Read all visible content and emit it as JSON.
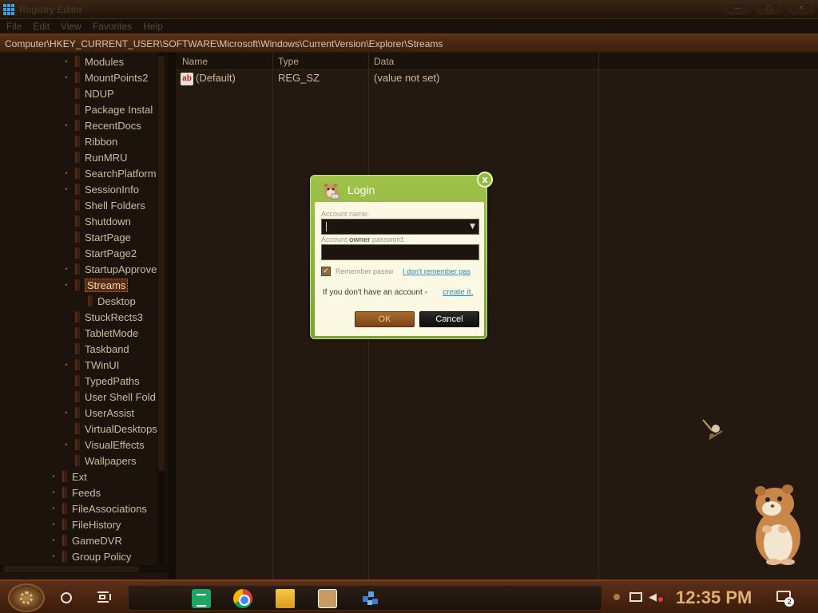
{
  "window": {
    "title": "Registry Editor",
    "buttons": [
      "—",
      "□",
      "✕"
    ]
  },
  "menu": [
    "File",
    "Edit",
    "View",
    "Favorites",
    "Help"
  ],
  "address": "Computer\\HKEY_CURRENT_USER\\SOFTWARE\\Microsoft\\Windows\\CurrentVersion\\Explorer\\Streams",
  "tree": [
    {
      "label": "Modules",
      "expander": true
    },
    {
      "label": "MountPoints2",
      "expander": true
    },
    {
      "label": "NDUP",
      "expander": false
    },
    {
      "label": "Package Instal",
      "expander": false
    },
    {
      "label": "RecentDocs",
      "expander": true
    },
    {
      "label": "Ribbon",
      "expander": false
    },
    {
      "label": "RunMRU",
      "expander": false
    },
    {
      "label": "SearchPlatform",
      "expander": true
    },
    {
      "label": "SessionInfo",
      "expander": true
    },
    {
      "label": "Shell Folders",
      "expander": false
    },
    {
      "label": "Shutdown",
      "expander": false
    },
    {
      "label": "StartPage",
      "expander": false
    },
    {
      "label": "StartPage2",
      "expander": false
    },
    {
      "label": "StartupApprove",
      "expander": true
    },
    {
      "label": "Streams",
      "expander": true,
      "selected": true
    },
    {
      "label": "Desktop",
      "expander": false
    },
    {
      "label": "StuckRects3",
      "expander": false
    },
    {
      "label": "TabletMode",
      "expander": false
    },
    {
      "label": "Taskband",
      "expander": false
    },
    {
      "label": "TWinUI",
      "expander": true
    },
    {
      "label": "TypedPaths",
      "expander": false
    },
    {
      "label": "User Shell Fold",
      "expander": false
    },
    {
      "label": "UserAssist",
      "expander": true
    },
    {
      "label": "VirtualDesktops",
      "expander": false
    },
    {
      "label": "VisualEffects",
      "expander": true
    },
    {
      "label": "Wallpapers",
      "expander": false
    },
    {
      "label": "Ext",
      "expander": true
    },
    {
      "label": "Feeds",
      "expander": true
    },
    {
      "label": "FileAssociations",
      "expander": true
    },
    {
      "label": "FileHistory",
      "expander": true
    },
    {
      "label": "GameDVR",
      "expander": true
    },
    {
      "label": "Group Policy",
      "expander": true
    }
  ],
  "list": {
    "columns": [
      "Name",
      "Type",
      "Data"
    ],
    "rows": [
      {
        "name": "(Default)",
        "type": "REG_SZ",
        "data": "(value not set)",
        "icon": "string-value-icon"
      }
    ]
  },
  "login": {
    "title": "Login",
    "close": "x",
    "account_name_label": "Account name:",
    "password_label_pre": "Account ",
    "password_label_bold": "owner",
    "password_label_post": " password:",
    "account_name_value": "",
    "password_value": "",
    "remember_label": "Remember passw",
    "remember_checked": true,
    "forgot_link": "I don't remember pas",
    "no_account_text": "If you don't have an account -",
    "create_link": "create it.",
    "ok_label": "OK",
    "cancel_label": "Cancel"
  },
  "taskbar": {
    "clock": "12:35 PM",
    "notification_count": "2",
    "pinned": [
      "google-sheets-icon",
      "chrome-icon",
      "file-explorer-icon",
      "hamster-app-icon",
      "regedit-icon"
    ]
  }
}
